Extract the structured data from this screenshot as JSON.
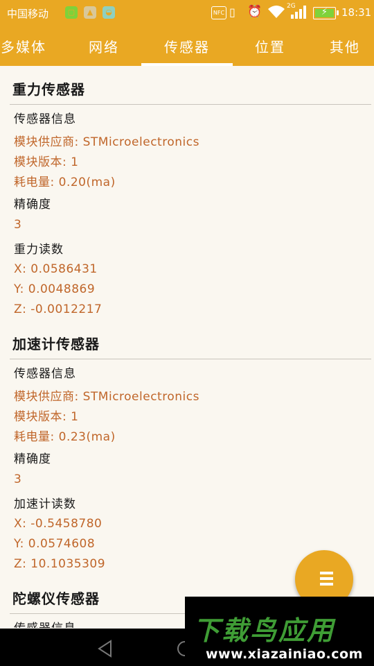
{
  "status_bar": {
    "carrier": "中国移动",
    "icons": [
      "notification-icon",
      "image-notification-icon",
      "android-notification-icon"
    ],
    "nfc": "NFC",
    "network_type": "2G",
    "time": "18:31"
  },
  "tabs": [
    {
      "label": "多媒体",
      "active": false
    },
    {
      "label": "网络",
      "active": false
    },
    {
      "label": "传感器",
      "active": true
    },
    {
      "label": "位置",
      "active": false
    },
    {
      "label": "其他",
      "active": false
    }
  ],
  "sections": [
    {
      "title": "重力传感器",
      "info_label": "传感器信息",
      "vendor": "模块供应商: STMicroelectronics",
      "version": "模块版本: 1",
      "power": "耗电量: 0.20(ma)",
      "accuracy_label": "精确度",
      "accuracy_value": "3",
      "reading_label": "重力读数",
      "x": "X: 0.0586431",
      "y": "Y: 0.0048869",
      "z": "Z: -0.0012217"
    },
    {
      "title": "加速计传感器",
      "info_label": "传感器信息",
      "vendor": "模块供应商: STMicroelectronics",
      "version": "模块版本: 1",
      "power": "耗电量: 0.23(ma)",
      "accuracy_label": "精确度",
      "accuracy_value": "3",
      "reading_label": "加速计读数",
      "x": "X: -0.5458780",
      "y": "Y: 0.0574608",
      "z": "Z: 10.1035309"
    },
    {
      "title": "陀螺仪传感器",
      "info_label": "传感器信息"
    }
  ],
  "fab": {
    "icon": "list-icon"
  },
  "watermark": {
    "logo": "下载鸟应用",
    "url": "www.xiazainiao.com"
  },
  "colors": {
    "accent": "#e9a823",
    "value_text": "#c0662a",
    "background": "#faf7f0"
  }
}
